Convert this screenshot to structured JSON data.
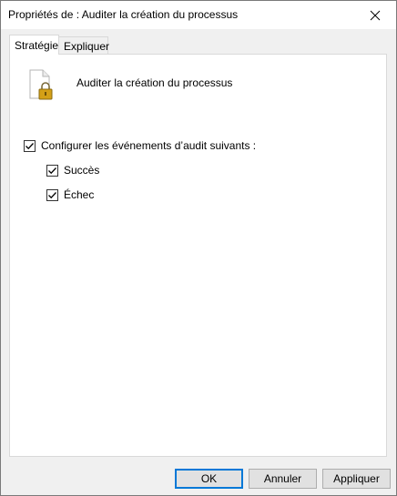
{
  "window": {
    "title": "Propriétés de : Auditer la création du processus",
    "close_icon": "close-icon"
  },
  "tabs": [
    {
      "label": "Stratégie",
      "active": true
    },
    {
      "label": "Expliquer",
      "active": false
    }
  ],
  "policy": {
    "icon": "policy-document-lock-icon",
    "name": "Auditer la création du processus"
  },
  "options": {
    "configure": {
      "label": "Configurer les événements d’audit suivants :",
      "checked": true
    },
    "success": {
      "label": "Succès",
      "checked": true
    },
    "failure": {
      "label": "Échec",
      "checked": true
    }
  },
  "buttons": {
    "ok": "OK",
    "cancel": "Annuler",
    "apply": "Appliquer"
  },
  "colors": {
    "accent": "#0078d7",
    "lock": "#d4a017"
  }
}
